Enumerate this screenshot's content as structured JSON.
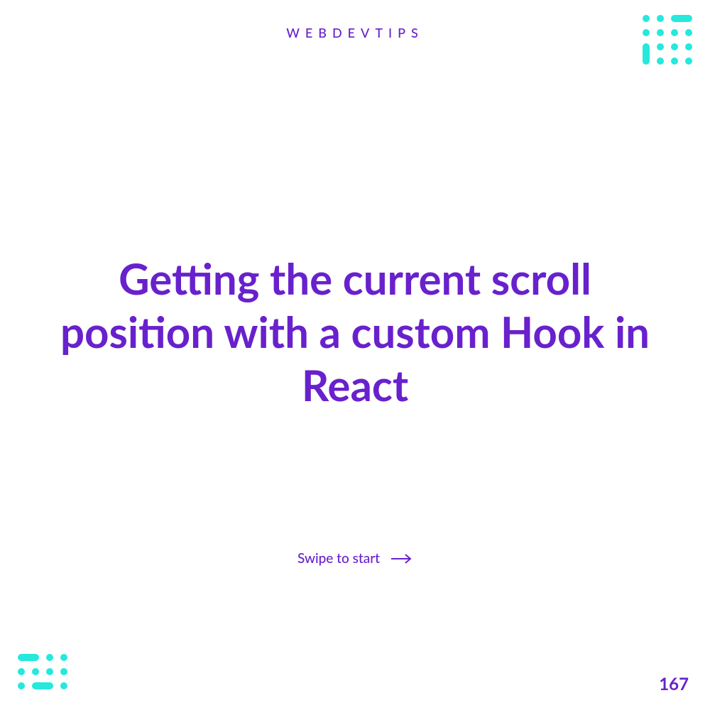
{
  "header": {
    "brand": "WEBDEVTIPS"
  },
  "content": {
    "title": "Getting the current scroll position with a custom Hook in React",
    "cta_label": "Swipe to start"
  },
  "footer": {
    "page_number": "167"
  },
  "colors": {
    "primary": "#6821cc",
    "accent": "#26e8dd"
  }
}
